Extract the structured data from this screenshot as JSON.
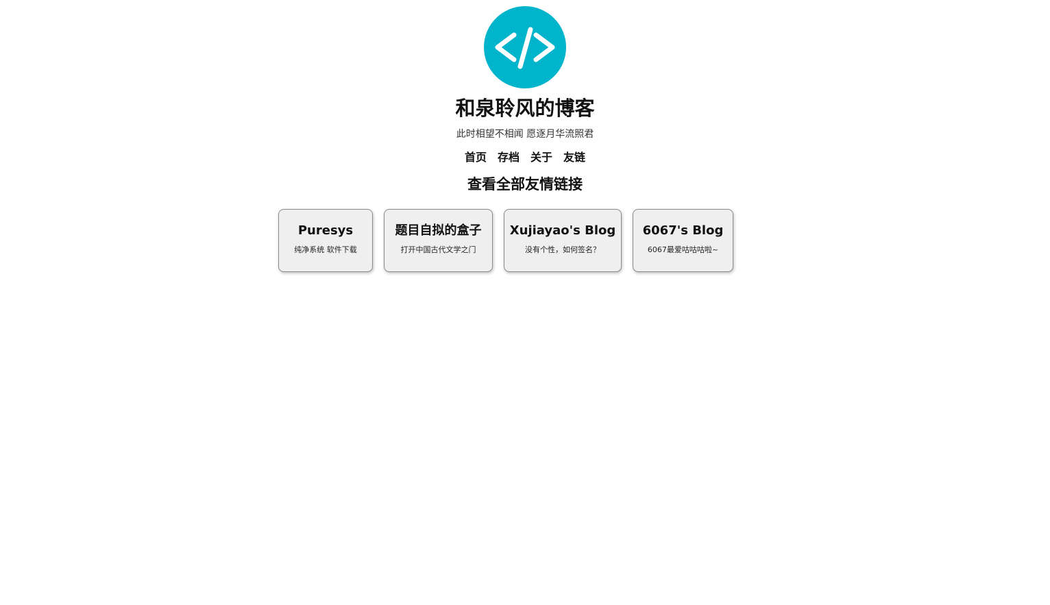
{
  "site": {
    "title": "和泉聆风的博客",
    "tagline": "此时相望不相闻 愿逐月华流照君",
    "logo_icon": "code-brackets-icon",
    "accent_color": "#00b4cc"
  },
  "nav": {
    "items": [
      {
        "label": "首页"
      },
      {
        "label": "存档"
      },
      {
        "label": "关于"
      },
      {
        "label": "友链"
      }
    ]
  },
  "main": {
    "heading": "查看全部友情链接",
    "links": [
      {
        "name": "Puresys",
        "desc": "纯净系统 软件下载"
      },
      {
        "name": "题目自拟的盒子",
        "desc": "打开中国古代文学之门"
      },
      {
        "name": "Xujiayao's Blog",
        "desc": "没有个性，如何签名？"
      },
      {
        "name": "6067's Blog",
        "desc": "6067最爱咕咕咕啦~"
      }
    ]
  }
}
